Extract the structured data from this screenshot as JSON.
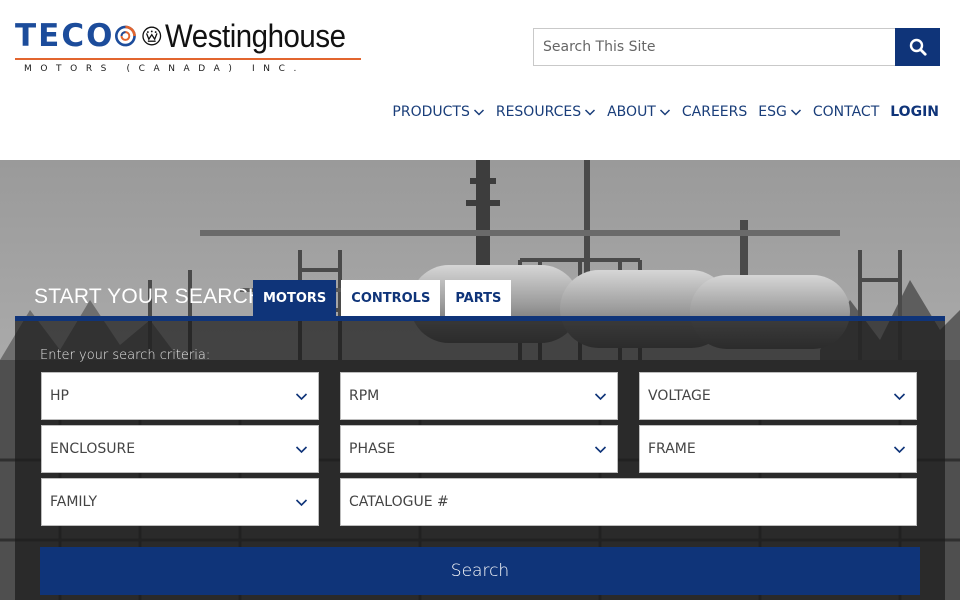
{
  "brand": {
    "teco": "TECO",
    "westinghouse": "Westinghouse",
    "subtitle": "MOTORS (CANADA) INC.",
    "colors": {
      "navy": "#0f3479",
      "teco_blue": "#1c4c9b",
      "orange": "#e2652f"
    }
  },
  "site_search": {
    "placeholder": "Search This Site",
    "icon": "search-icon"
  },
  "nav": {
    "products": "PRODUCTS",
    "resources": "RESOURCES",
    "about": "ABOUT",
    "careers": "CAREERS",
    "esg": "ESG",
    "contact": "CONTACT",
    "login": "LOGIN"
  },
  "hero": {
    "start_label": "START YOUR SEARCH:",
    "tabs": {
      "motors": "MOTORS",
      "controls": "CONTROLS",
      "parts": "PARTS"
    },
    "active_tab": "MOTORS",
    "hint": "Enter your search criteria:",
    "fields": {
      "hp": "HP",
      "rpm": "RPM",
      "voltage": "VOLTAGE",
      "enclosure": "ENCLOSURE",
      "phase": "PHASE",
      "frame": "FRAME",
      "family": "FAMILY",
      "catalogue": "CATALOGUE #"
    },
    "search_button": "Search"
  }
}
